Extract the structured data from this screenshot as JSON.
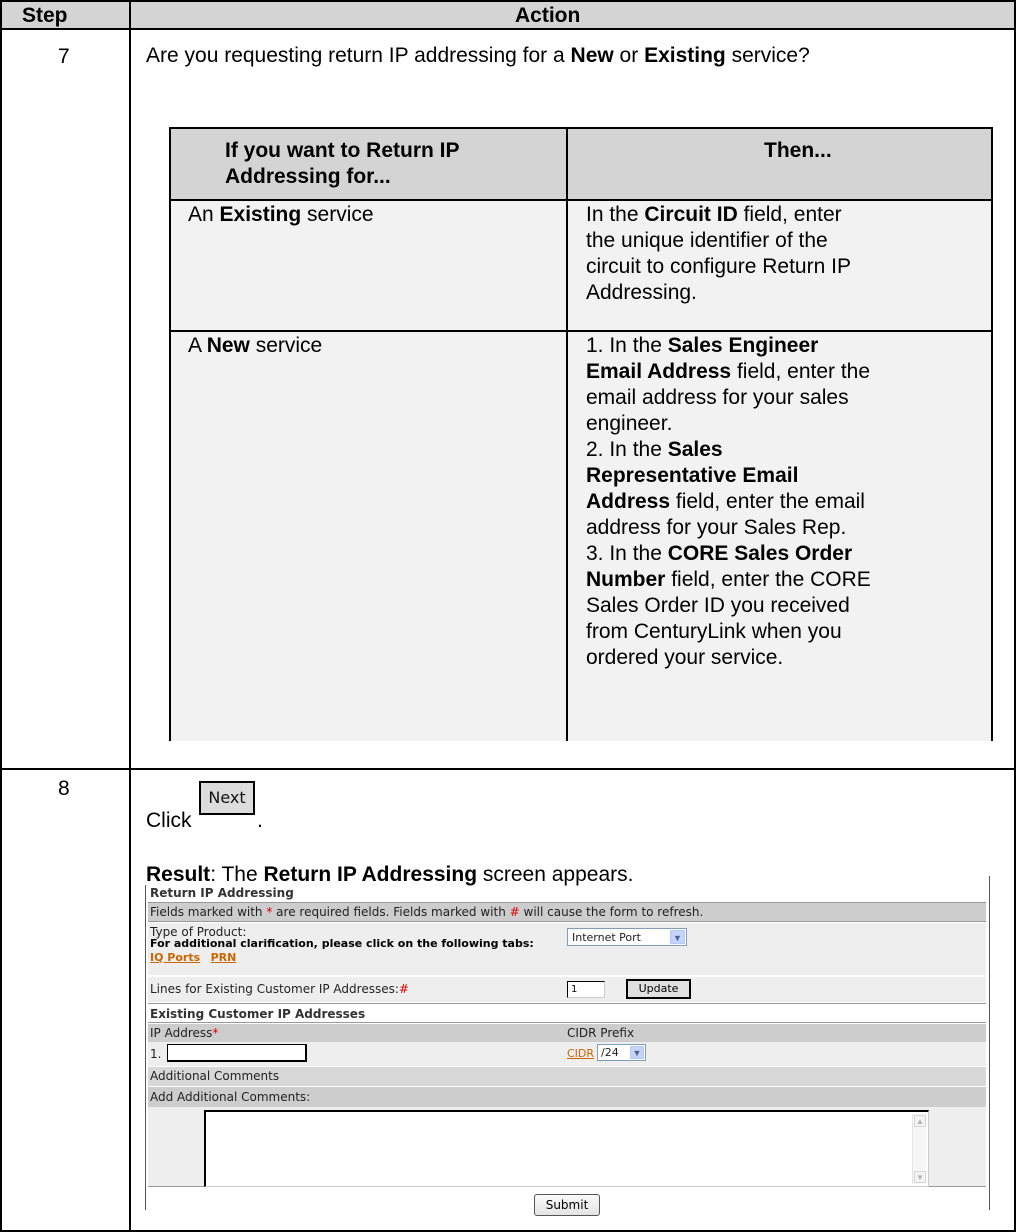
{
  "table": {
    "header_step": "Step",
    "header_action": "Action"
  },
  "step7": {
    "number": "7",
    "question_1": "Are you requesting return IP addressing for a ",
    "question_new": "New",
    "question_or": " or ",
    "question_existing": "Existing",
    "question_2": " service?",
    "inner_header_left_1": "If you want to Return IP",
    "inner_header_left_2": "Addressing for...",
    "inner_header_right": "Then...",
    "row1_left_pre": "An ",
    "row1_left_bold": "Existing",
    "row1_left_post": " service",
    "row1_right": {
      "l1_pre": "In the ",
      "l1_bold": "Circuit ID",
      "l1_post": " field, enter",
      "l2": "the unique identifier of the",
      "l3": "circuit to configure Return IP",
      "l4": "Addressing."
    },
    "row2_left_pre": "A ",
    "row2_left_bold": "New",
    "row2_left_post": " service",
    "row2_right": {
      "l1_pre": "1. In the ",
      "l1_bold": "Sales Engineer",
      "l2_bold": "Email Address",
      "l2_post": " field, enter the",
      "l3": "email address for your sales",
      "l4": "engineer.",
      "l5_pre": "2. In the ",
      "l5_bold": "Sales",
      "l6_bold": "Representative Email",
      "l7_bold": "Address",
      "l7_post": " field, enter the email",
      "l8": "address for your Sales Rep.",
      "l9_pre": "3. In the ",
      "l9_bold": "CORE Sales Order",
      "l10_bold": "Number",
      "l10_post": " field, enter the CORE",
      "l11": "Sales Order ID you received",
      "l12": "from CenturyLink when you",
      "l13": "ordered your service."
    }
  },
  "step8": {
    "number": "8",
    "click": "Click ",
    "next_button": "Next",
    "period": ".",
    "result_label": "Result",
    "result_colon": ":  The ",
    "result_bold": "Return IP Addressing",
    "result_post": " screen appears."
  },
  "form": {
    "title": "Return IP Addressing",
    "notice_1": "Fields marked with ",
    "notice_star": "*",
    "notice_2": " are required fields. Fields marked with ",
    "notice_hash": "#",
    "notice_3": " will cause the form to refresh.",
    "product_label": "Type of Product:",
    "product_hint": "For additional clarification, please click on the following tabs:",
    "link_iq_ports": "IQ Ports",
    "link_prn": "PRN",
    "product_value": "Internet Port",
    "lines_label": "Lines for Existing Customer IP Addresses:",
    "lines_hash": "#",
    "lines_value": "1",
    "update_button": "Update",
    "existing_section": "Existing Customer IP Addresses",
    "col_ip": "IP Address",
    "col_ip_star": "*",
    "col_cidr": "CIDR Prefix",
    "row_number": "1.",
    "ip_value": "",
    "cidr_link": "CIDR",
    "cidr_value": "/24",
    "additional_section": "Additional Comments",
    "add_comments_label": "Add Additional Comments:",
    "comments_value": "",
    "submit_button": "Submit"
  }
}
